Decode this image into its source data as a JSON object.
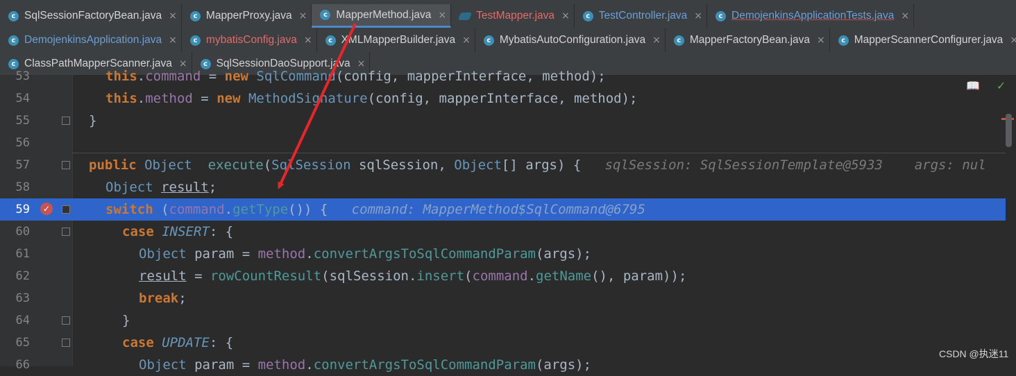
{
  "tabs_row1": [
    {
      "label": "SqlSessionFactoryBean.java",
      "icon": "class-icon",
      "style": "normal"
    },
    {
      "label": "MapperProxy.java",
      "icon": "class-icon",
      "style": "normal"
    },
    {
      "label": "MapperMethod.java",
      "icon": "class-icon",
      "style": "active"
    },
    {
      "label": "TestMapper.java",
      "icon": "test-mapper-icon",
      "style": "red"
    },
    {
      "label": "TestController.java",
      "icon": "class-icon",
      "style": "blue"
    },
    {
      "label": "DemojenkinsApplicationTests.java",
      "icon": "class-icon",
      "style": "red-underline"
    }
  ],
  "tabs_row2": [
    {
      "label": "DemojenkinsApplication.java",
      "icon": "class-icon",
      "style": "blue"
    },
    {
      "label": "mybatisConfig.java",
      "icon": "class-icon",
      "style": "red"
    },
    {
      "label": "XMLMapperBuilder.java",
      "icon": "class-icon",
      "style": "normal"
    },
    {
      "label": "MybatisAutoConfiguration.java",
      "icon": "class-icon",
      "style": "normal"
    },
    {
      "label": "MapperFactoryBean.java",
      "icon": "class-icon",
      "style": "normal"
    },
    {
      "label": "MapperScannerConfigurer.java",
      "icon": "class-icon",
      "style": "normal"
    }
  ],
  "tabs_row3": [
    {
      "label": "ClassPathMapperScanner.java",
      "icon": "class-icon",
      "style": "normal"
    },
    {
      "label": "SqlSessionDaoSupport.java",
      "icon": "class-icon",
      "style": "normal"
    }
  ],
  "close_glyph": "×",
  "lines": [
    {
      "n": "53"
    },
    {
      "n": "54"
    },
    {
      "n": "55"
    },
    {
      "n": "56"
    },
    {
      "n": "57"
    },
    {
      "n": "58"
    },
    {
      "n": "59"
    },
    {
      "n": "60"
    },
    {
      "n": "61"
    },
    {
      "n": "62"
    },
    {
      "n": "63"
    },
    {
      "n": "64"
    },
    {
      "n": "65"
    },
    {
      "n": "66"
    }
  ],
  "code": {
    "l53": {
      "kw": "this",
      "dot": ".",
      "fld": "command",
      "eq": " = ",
      "kw2": "new",
      "sp": " ",
      "type": "SqlCommand",
      "rest": "(config, mapperInterface, method);"
    },
    "l54": {
      "kw": "this",
      "dot": ".",
      "fld": "method",
      "eq": " = ",
      "kw2": "new",
      "sp": " ",
      "type": "MethodSignature",
      "rest": "(config, mapperInterface, method);"
    },
    "l55": {
      "text": "}"
    },
    "l57": {
      "kw": "public",
      "sp": " ",
      "type": "Object",
      "gap": "  ",
      "name": "execute",
      "p1": "(",
      "t1": "SqlSession",
      "a1": " sqlSession, ",
      "t2": "Object",
      "a2": "[] args) {",
      "hint": "   sqlSession: SqlSessionTemplate@5933    args: nul"
    },
    "l58": {
      "type": "Object",
      "sp": " ",
      "var": "result",
      "rest": ";"
    },
    "l59": {
      "kw": "switch",
      "p1": " (",
      "fld": "command",
      "dot": ".",
      "call": "getType",
      "rest": "()) {",
      "hint": "   command: MapperMethod$SqlCommand@6795"
    },
    "l60": {
      "kw": "case",
      "sp": " ",
      "enum": "INSERT",
      "rest": ": {"
    },
    "l61": {
      "type": "Object",
      "a": " param = ",
      "fld": "method",
      "dot": ".",
      "call": "convertArgsToSqlCommandParam",
      "rest": "(args);"
    },
    "l62": {
      "var": "result",
      "a": " = ",
      "call": "rowCountResult",
      "b": "(sqlSession.",
      "call2": "insert",
      "c": "(",
      "fld": "command",
      "dot": ".",
      "call3": "getName",
      "rest": "(), param));"
    },
    "l63": {
      "kw": "break",
      "rest": ";"
    },
    "l64": {
      "text": "}"
    },
    "l65": {
      "kw": "case",
      "sp": " ",
      "enum": "UPDATE",
      "rest": ": {"
    },
    "l66": {
      "type": "Object",
      "a": " param = ",
      "fld": "method",
      "dot": ".",
      "call": "convertArgsToSqlCommandParam",
      "rest": "(args);"
    }
  },
  "toolbar": {
    "reader_icon": "book-icon",
    "reader_glyph": "📖",
    "ok_icon": "check-icon",
    "ok_glyph": "✓"
  },
  "breakpoint_glyph": "✓",
  "watermark": "CSDN @执迷11",
  "colors": {
    "highlight": "#2f65ca",
    "arrow": "#e8262a",
    "keyword": "#cc7832"
  }
}
